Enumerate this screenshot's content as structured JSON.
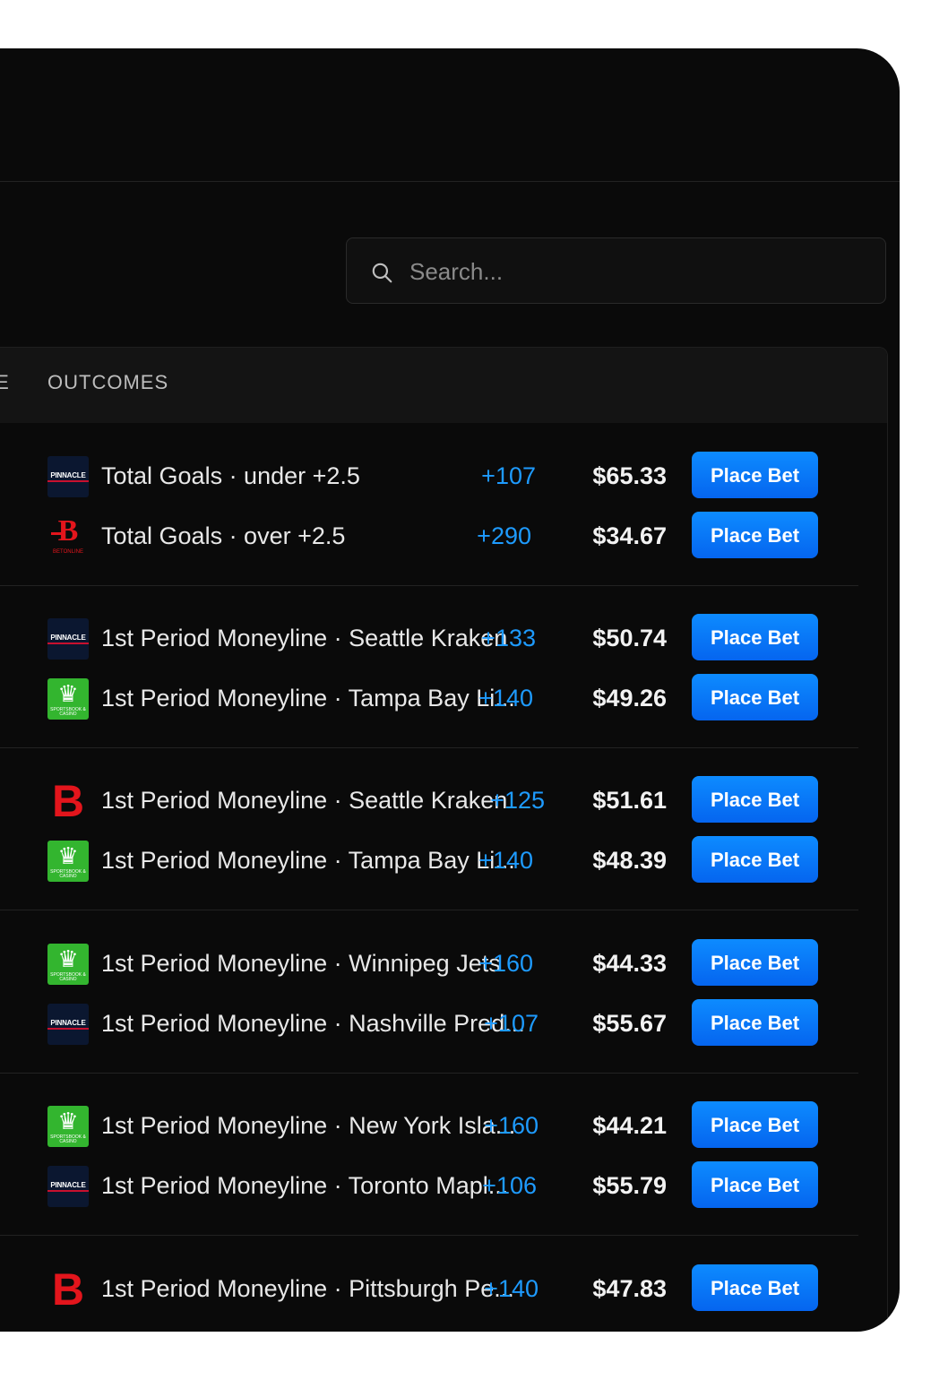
{
  "search": {
    "placeholder": "Search..."
  },
  "table": {
    "columns": [
      "IE",
      "OUTCOMES"
    ],
    "groups": [
      {
        "rows": [
          {
            "book": "pinnacle",
            "logo_text": "PINNACLE",
            "desc": "Total Goals · under +2.5",
            "odds": "+107",
            "amount": "$65.33",
            "button": "Place Bet"
          },
          {
            "book": "betonline",
            "logo_text": "BETONLINE",
            "desc": "Total Goals · over +2.5",
            "odds": "+290",
            "amount": "$34.67",
            "button": "Place Bet"
          }
        ]
      },
      {
        "rows": [
          {
            "book": "pinnacle",
            "logo_text": "PINNACLE",
            "desc": "1st Period Moneyline · Seattle Kraken",
            "odds": "+133",
            "amount": "$50.74",
            "button": "Place Bet"
          },
          {
            "book": "draftkings",
            "logo_text": "SPORTSBOOK & CASINO",
            "desc": "1st Period Moneyline · Tampa Bay Li...",
            "odds": "+140",
            "amount": "$49.26",
            "button": "Place Bet"
          }
        ]
      },
      {
        "rows": [
          {
            "book": "betrivers",
            "logo_text": "",
            "desc": "1st Period Moneyline · Seattle Kraken",
            "odds": "+125",
            "amount": "$51.61",
            "button": "Place Bet"
          },
          {
            "book": "draftkings",
            "logo_text": "SPORTSBOOK & CASINO",
            "desc": "1st Period Moneyline · Tampa Bay Li...",
            "odds": "+140",
            "amount": "$48.39",
            "button": "Place Bet"
          }
        ]
      },
      {
        "rows": [
          {
            "book": "draftkings",
            "logo_text": "SPORTSBOOK & CASINO",
            "desc": "1st Period Moneyline · Winnipeg Jets",
            "odds": "+160",
            "amount": "$44.33",
            "button": "Place Bet"
          },
          {
            "book": "pinnacle",
            "logo_text": "PINNACLE",
            "desc": "1st Period Moneyline · Nashville Pred...",
            "odds": "+107",
            "amount": "$55.67",
            "button": "Place Bet"
          }
        ]
      },
      {
        "rows": [
          {
            "book": "draftkings",
            "logo_text": "SPORTSBOOK & CASINO",
            "desc": "1st Period Moneyline · New York Isla...",
            "odds": "+160",
            "amount": "$44.21",
            "button": "Place Bet"
          },
          {
            "book": "pinnacle",
            "logo_text": "PINNACLE",
            "desc": "1st Period Moneyline · Toronto Mapl...",
            "odds": "+106",
            "amount": "$55.79",
            "button": "Place Bet"
          }
        ]
      },
      {
        "rows": [
          {
            "book": "betrivers",
            "logo_text": "",
            "desc": "1st Period Moneyline · Pittsburgh Pe...",
            "odds": "+140",
            "amount": "$47.83",
            "button": "Place Bet"
          }
        ]
      }
    ]
  },
  "colors": {
    "background": "#0a0a0a",
    "accent": "#0a7cff",
    "odds": "#1e9bff"
  }
}
